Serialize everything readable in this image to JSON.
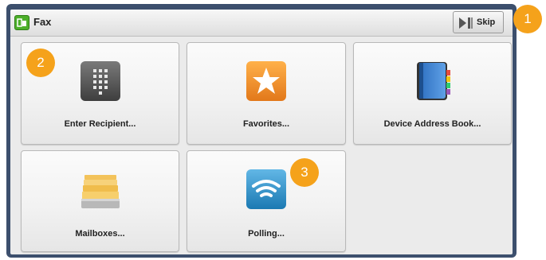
{
  "header": {
    "title": "Fax",
    "skip_label": "Skip",
    "app_icon": "fax-app-icon"
  },
  "tiles": [
    {
      "label": "Enter Recipient...",
      "icon": "keypad-icon"
    },
    {
      "label": "Favorites...",
      "icon": "star-icon"
    },
    {
      "label": "Device Address Book...",
      "icon": "address-book-icon"
    },
    {
      "label": "Mailboxes...",
      "icon": "mailbox-folders-icon"
    },
    {
      "label": "Polling...",
      "icon": "wifi-polling-icon"
    }
  ],
  "callouts": [
    "1",
    "2",
    "3"
  ],
  "colors": {
    "frame": "#3c4f6d",
    "callout": "#f5a21b",
    "app_icon": "#4caf2a",
    "star_tile": "#f39a2b",
    "polling_tile": "#2e8fc3"
  }
}
